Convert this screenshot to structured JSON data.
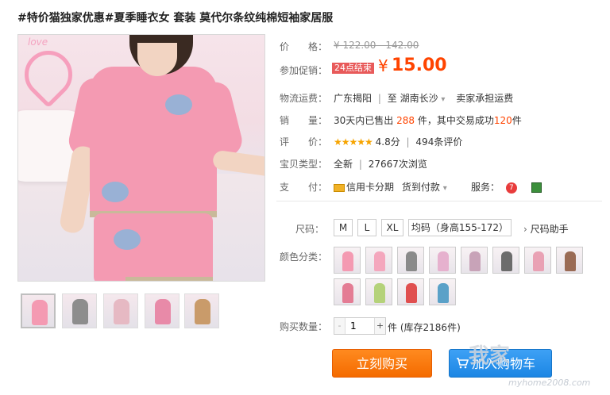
{
  "title": "#特价猫独家优惠#夏季睡衣女 套装 莫代尔条纹纯棉短袖家居服",
  "price_row": {
    "label": "价　　格：",
    "original": "¥ 122.00 - 142.00"
  },
  "promo_row": {
    "label": "参加促销：",
    "tag": "24点结束",
    "currency": "¥",
    "price": "15.00"
  },
  "shipping_row": {
    "label": "物流运费：",
    "from": "广东揭阳",
    "to": "至",
    "dest": "湖南长沙",
    "dest_chevron": "▾",
    "fee": "卖家承担运费"
  },
  "sales_row": {
    "label": "销　　量：",
    "prefix": "30天内已售出",
    "sold": "288",
    "mid": "件，其中交易成功",
    "success": "120",
    "suffix": "件"
  },
  "rating_row": {
    "label": "评　　价：",
    "stars": "★★★★★",
    "score": "4.8分",
    "reviews": "494条评价"
  },
  "type_row": {
    "label": "宝贝类型：",
    "condition": "全新",
    "views": "27667次浏览"
  },
  "payment_row": {
    "label": "支　　付：",
    "credit": "信用卡分期",
    "cod": "货到付款",
    "service_label": "服务："
  },
  "size": {
    "label": "尺码：",
    "options": [
      "M",
      "L",
      "XL",
      "均码（身高155-172）"
    ],
    "helper": "尺码助手"
  },
  "color": {
    "label": "颜色分类："
  },
  "quantity": {
    "label": "购买数量：",
    "value": "1",
    "minus": "-",
    "plus": "+",
    "unit": "件",
    "stock": "(库存2186件)"
  },
  "buttons": {
    "buy": "立刻购买",
    "cart": "加入购物车"
  },
  "watermark": {
    "text": "我家",
    "url": "myhome2008.com"
  },
  "image_text": {
    "love": "love"
  },
  "colors": {
    "accent": "#ff4400",
    "buy": "#f46b00",
    "cart": "#1c86e4",
    "promo_tag": "#e85a5a",
    "star": "#f6a400"
  }
}
